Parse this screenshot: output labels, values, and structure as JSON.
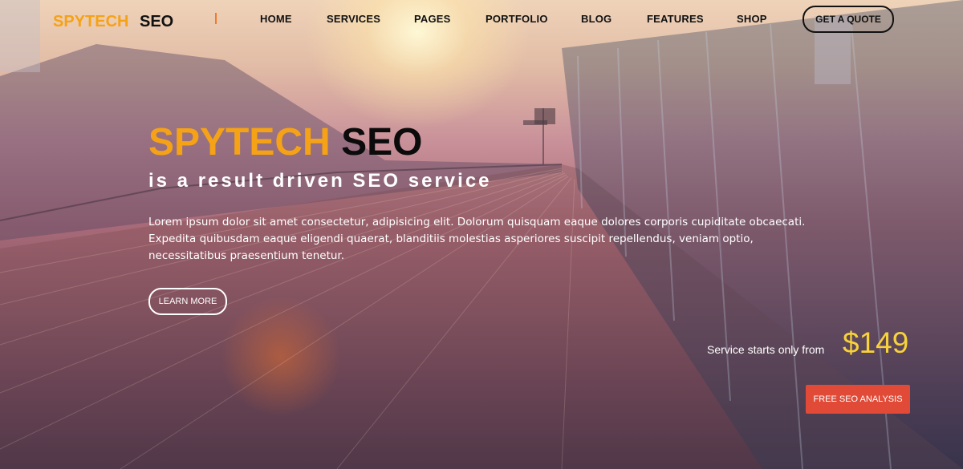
{
  "brand": {
    "name_part1": "SPYTECH",
    "name_part2": "SEO"
  },
  "nav": {
    "items": [
      "HOME",
      "SERVICES",
      "PAGES",
      "PORTFOLIO",
      "BLOG",
      "FEATURES",
      "SHOP"
    ],
    "cta_label": "GET A QUOTE"
  },
  "hero": {
    "headline_part1": "SPYTECH",
    "headline_part2": "SEO",
    "tagline": "is a result driven SEO service",
    "body": "Lorem ipsum dolor sit amet consectetur, adipisicing elit. Dolorum quisquam eaque dolores corporis cupiditate obcaecati. Expedita quibusdam eaque eligendi quaerat, blanditiis molestias asperiores suscipit repellendus, veniam optio, necessitatibus praesentium tenetur.",
    "learn_more_label": "LEARN MORE"
  },
  "pricing": {
    "starts_text": "Service starts only from",
    "price": "$149",
    "cta_label": "FREE SEO ANALYSIS"
  },
  "colors": {
    "brand_orange": "#f5a216",
    "price_yellow": "#f7d23a",
    "cta_red": "#e14a37"
  }
}
